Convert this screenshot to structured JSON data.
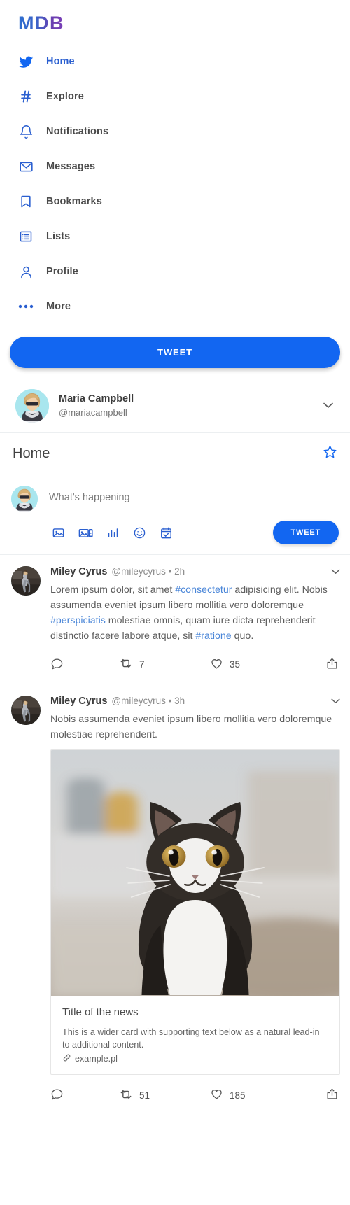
{
  "brand": {
    "logo": "MDB"
  },
  "sidebar": {
    "items": [
      {
        "label": "Home",
        "icon": "twitter-bird-icon",
        "active": true
      },
      {
        "label": "Explore",
        "icon": "hashtag-icon",
        "active": false
      },
      {
        "label": "Notifications",
        "icon": "bell-icon",
        "active": false
      },
      {
        "label": "Messages",
        "icon": "envelope-icon",
        "active": false
      },
      {
        "label": "Bookmarks",
        "icon": "bookmark-icon",
        "active": false
      },
      {
        "label": "Lists",
        "icon": "list-icon",
        "active": false
      },
      {
        "label": "Profile",
        "icon": "person-icon",
        "active": false
      },
      {
        "label": "More",
        "icon": "ellipsis-icon",
        "active": false
      }
    ],
    "tweet_button": "TWEET",
    "account": {
      "name": "Maria Campbell",
      "handle": "@mariacampbell",
      "caret": "⌄"
    }
  },
  "header": {
    "title": "Home",
    "star_icon": "star-outline-icon"
  },
  "compose": {
    "placeholder": "What's happening",
    "value": "",
    "icons": [
      "image-icon",
      "gif-icon",
      "poll-chart-icon",
      "emoji-icon",
      "schedule-icon"
    ],
    "tweet_button": "TWEET"
  },
  "feed": [
    {
      "author": "Miley Cyrus",
      "handle": "@mileycyrus",
      "separator": "•",
      "time": "2h",
      "caret": "⌄",
      "text_parts": [
        {
          "t": "Lorem ipsum dolor, sit amet ",
          "hash": false
        },
        {
          "t": "#consectetur",
          "hash": true
        },
        {
          "t": " adipisicing elit. Nobis assumenda eveniet ipsum libero mollitia vero doloremque ",
          "hash": false
        },
        {
          "t": "#perspiciatis",
          "hash": true
        },
        {
          "t": " molestiae omnis, quam iure dicta reprehenderit distinctio facere labore atque, sit ",
          "hash": false
        },
        {
          "t": "#ratione",
          "hash": true
        },
        {
          "t": " quo.",
          "hash": false
        }
      ],
      "actions": {
        "comment_icon": "comment-icon",
        "comment_count": "",
        "retweet_icon": "retweet-icon",
        "retweet_count": "7",
        "like_icon": "heart-icon",
        "like_count": "35",
        "share_icon": "share-icon"
      },
      "card": null
    },
    {
      "author": "Miley Cyrus",
      "handle": "@mileycyrus",
      "separator": "•",
      "time": "3h",
      "caret": "⌄",
      "text_parts": [
        {
          "t": "Nobis assumenda eveniet ipsum libero mollitia vero doloremque molestiae reprehenderit.",
          "hash": false
        }
      ],
      "actions": {
        "comment_icon": "comment-icon",
        "comment_count": "",
        "retweet_icon": "retweet-icon",
        "retweet_count": "51",
        "like_icon": "heart-icon",
        "like_count": "185",
        "share_icon": "share-icon"
      },
      "card": {
        "image_alt": "black and white cat photo",
        "title": "Title of the news",
        "text": "This is a wider card with supporting text below as a natural lead-in to additional content.",
        "link_icon": "link-icon",
        "link": "example.pl"
      }
    }
  ],
  "colors": {
    "brand_blue": "#1266f1",
    "icon_blue": "#2a5fd0",
    "hashtag_blue": "#4a86d8",
    "text_gray": "#5d5d5d",
    "muted_gray": "#8a8a8a",
    "border": "#eceff1"
  }
}
